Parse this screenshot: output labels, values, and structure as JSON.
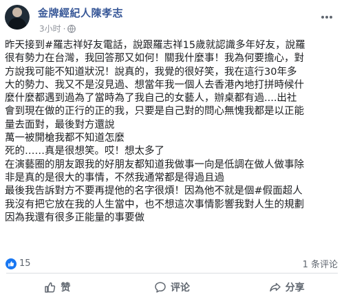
{
  "post": {
    "author": "金牌經紀人陳孝志",
    "time": "3小时",
    "separator": "·",
    "icons": {
      "audience": "globe-icon",
      "options": "more-options-icon"
    },
    "lines": [
      "昨天接到#羅志祥好友電話，說跟羅志祥15歲就認識多年好友，說羅",
      "很有勢力在台灣，我回答那又如何！關我什麼事！我為何要擔心，對",
      "方說我可能不知道狀況！說真的，我覺的很好笑，我在這行30年多",
      "大的勢力、我又不是沒見過、想當年我一個人去香港內地打拼時候什",
      "麼什麼都遇到過為了當時為了我自己的女藝人，辦桌都有過....出社",
      "會到現在做的正行的正的我，只要是自己對的問心無愧我都是以正能",
      "量去面對，最後對方還說",
      "萬一被開槍我都不知道怎麼",
      "死的……真是很想笑。哎！想太多了",
      "在演藝圈的朋友跟我的好朋友都知道我做事一向是低調在做人做事除",
      "非是真的是很大的事情，不然我通常都是得過且過",
      "最後我告訴對方不要再提他的名字很煩！因為他不就是個#假面超人",
      "我沒有把它放在我的人生當中，也不想這次事情影響我對人生的規劃",
      "因為我還有很多正能量的事要做"
    ]
  },
  "stats": {
    "likes": "15",
    "comments": "1 条评论",
    "like_icon": "thumbs-up-icon"
  },
  "actions": [
    {
      "label": "赞",
      "icon": "thumbs-up-icon"
    },
    {
      "label": "评论",
      "icon": "comment-icon"
    },
    {
      "label": "分享",
      "icon": "share-icon"
    }
  ],
  "colors": {
    "author": "#385898",
    "meta": "#90949c",
    "text": "#1c1e21",
    "like_badge": "#1877f2",
    "action": "#606770"
  }
}
